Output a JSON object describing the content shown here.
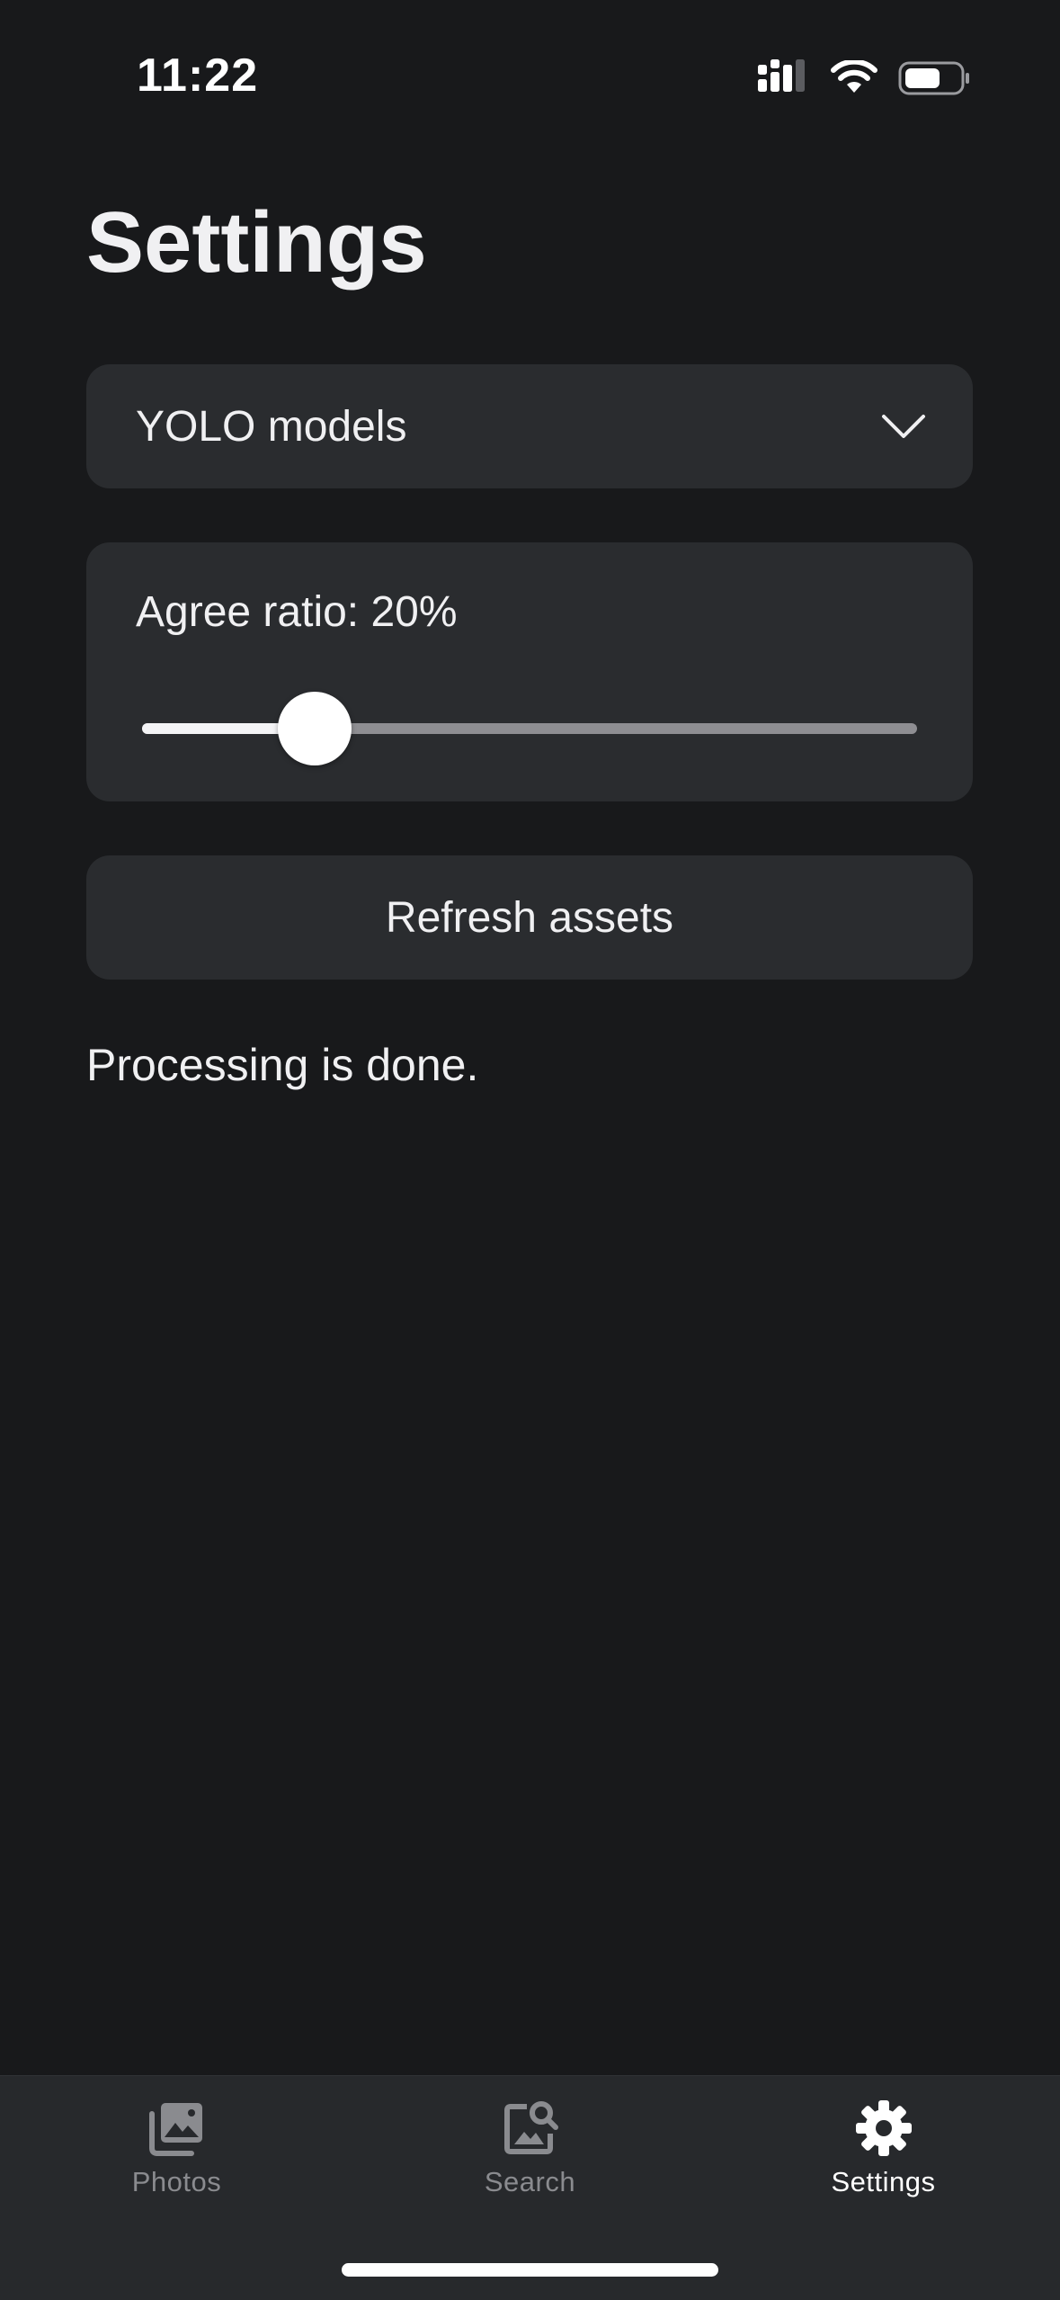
{
  "status_bar": {
    "time": "11:22"
  },
  "page": {
    "title": "Settings"
  },
  "model_select": {
    "selected": "YOLO models"
  },
  "agree_ratio": {
    "label": "Agree ratio: 20%",
    "value_percent": 20
  },
  "refresh": {
    "label": "Refresh assets"
  },
  "status": {
    "message": "Processing is done."
  },
  "tab_bar": {
    "tabs": [
      {
        "label": "Photos",
        "icon": "photos-icon",
        "active": false
      },
      {
        "label": "Search",
        "icon": "image-search-icon",
        "active": false
      },
      {
        "label": "Settings",
        "icon": "gear-icon",
        "active": true
      }
    ]
  },
  "colors": {
    "background": "#18191b",
    "card": "#2a2c2f",
    "tab_bar": "#27292c",
    "active_tab": "#ffffff",
    "inactive_tab": "#8a8b8f"
  }
}
